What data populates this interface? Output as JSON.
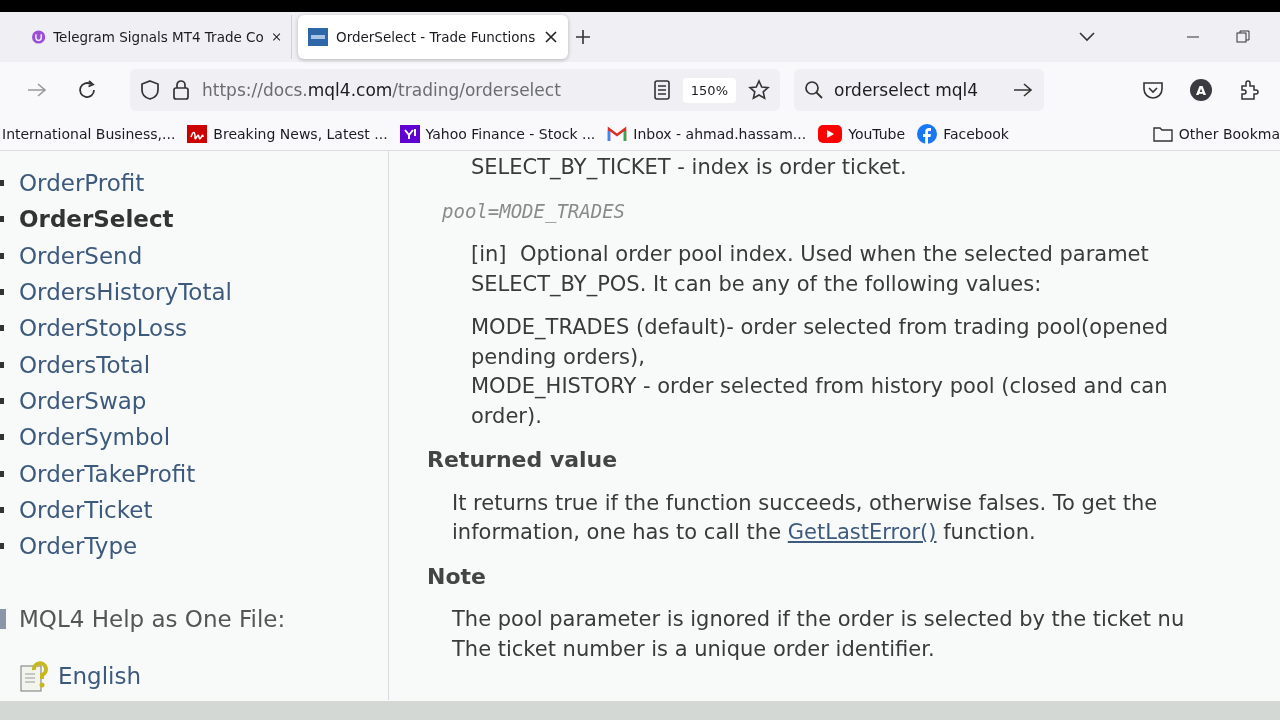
{
  "tabs": [
    {
      "title": "Telegram Signals MT4 Trade Co",
      "selected": false
    },
    {
      "title": "OrderSelect - Trade Functions",
      "selected": true
    }
  ],
  "address_bar": {
    "host_prefix": "https://docs.",
    "host": "mql4.com",
    "path": "/trading/orderselect",
    "zoom": "150%"
  },
  "search": {
    "value": "orderselect mql4"
  },
  "account_initial": "A",
  "bookmarks": [
    {
      "label": "International Business,..."
    },
    {
      "label": "Breaking News, Latest ..."
    },
    {
      "label": "Yahoo Finance - Stock ..."
    },
    {
      "label": "Inbox - ahmad.hassam..."
    },
    {
      "label": "YouTube"
    },
    {
      "label": "Facebook"
    }
  ],
  "other_bookmarks": "Other Bookma",
  "sidebar": {
    "items": [
      {
        "label": "OrderProfit",
        "selected": false
      },
      {
        "label": "OrderSelect",
        "selected": true
      },
      {
        "label": "OrderSend",
        "selected": false
      },
      {
        "label": "OrdersHistoryTotal",
        "selected": false
      },
      {
        "label": "OrderStopLoss",
        "selected": false
      },
      {
        "label": "OrdersTotal",
        "selected": false
      },
      {
        "label": "OrderSwap",
        "selected": false
      },
      {
        "label": "OrderSymbol",
        "selected": false
      },
      {
        "label": "OrderTakeProfit",
        "selected": false
      },
      {
        "label": "OrderTicket",
        "selected": false
      },
      {
        "label": "OrderType",
        "selected": false
      }
    ],
    "help_heading": "MQL4 Help as One File:",
    "help_link": "English"
  },
  "content": [
    {
      "kind": "param_text",
      "lines": [
        "SELECT_BY_TICKET - index is order ticket."
      ]
    },
    {
      "kind": "param",
      "lines": [
        "pool=MODE_TRADES"
      ]
    },
    {
      "kind": "param_text",
      "lines": [
        "[in]  Optional order pool index. Used when the selected paramet",
        "SELECT_BY_POS. It can be any of the following values:"
      ]
    },
    {
      "kind": "param_text",
      "lines": [
        "MODE_TRADES (default)- order selected from trading pool(opened",
        "pending orders),",
        "MODE_HISTORY - order selected from history pool (closed and can",
        "order)."
      ]
    },
    {
      "kind": "heading",
      "lines": [
        "Returned value"
      ]
    },
    {
      "kind": "text",
      "lines": [
        "It returns true if the function succeeds, otherwise falses. To get the"
      ],
      "link_line": {
        "before": "information, one has to call the ",
        "link": "GetLastError()",
        "after": " function."
      }
    },
    {
      "kind": "heading",
      "lines": [
        "Note"
      ]
    },
    {
      "kind": "text",
      "lines": [
        "The pool parameter is ignored if the order is selected by the ticket nu",
        "The ticket number is a unique order identifier."
      ]
    }
  ]
}
